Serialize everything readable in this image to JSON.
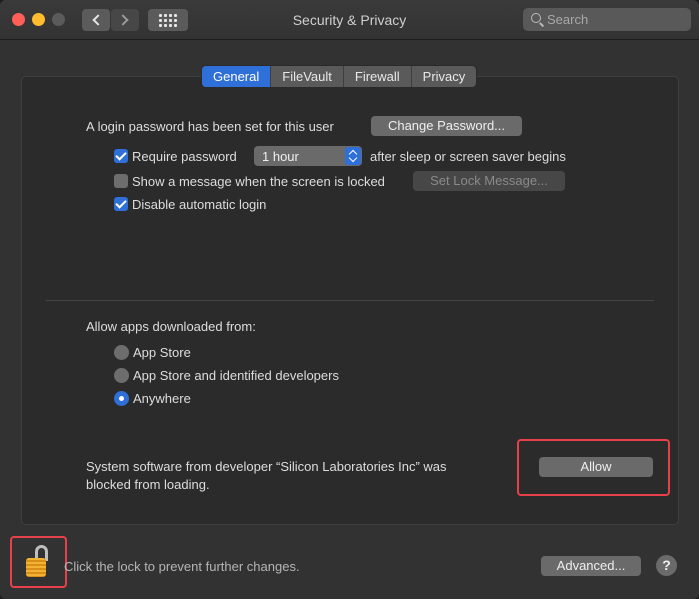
{
  "window": {
    "title": "Security & Privacy"
  },
  "search": {
    "placeholder": "Search"
  },
  "tabs": [
    {
      "label": "General",
      "active": true
    },
    {
      "label": "FileVault",
      "active": false
    },
    {
      "label": "Firewall",
      "active": false
    },
    {
      "label": "Privacy",
      "active": false
    }
  ],
  "general": {
    "login_password_text": "A login password has been set for this user",
    "change_password_label": "Change Password...",
    "require_password": {
      "label": "Require password",
      "checked": true,
      "select_value": "1 hour",
      "suffix": "after sleep or screen saver begins"
    },
    "show_message": {
      "label": "Show a message when the screen is locked",
      "checked": false,
      "button_label": "Set Lock Message..."
    },
    "disable_auto_login": {
      "label": "Disable automatic login",
      "checked": true
    },
    "allow_apps_heading": "Allow apps downloaded from:",
    "allow_apps_options": [
      {
        "label": "App Store",
        "selected": false
      },
      {
        "label": "App Store and identified developers",
        "selected": false
      },
      {
        "label": "Anywhere",
        "selected": true
      }
    ],
    "blocked_text_line1": "System software from developer “Silicon Laboratories Inc” was",
    "blocked_text_line2": "blocked from loading.",
    "allow_label": "Allow"
  },
  "footer": {
    "lock_text": "Click the lock to prevent further changes.",
    "advanced_label": "Advanced...",
    "help_label": "?"
  },
  "colors": {
    "accent": "#2f6fd8",
    "highlight": "#e8404a"
  }
}
